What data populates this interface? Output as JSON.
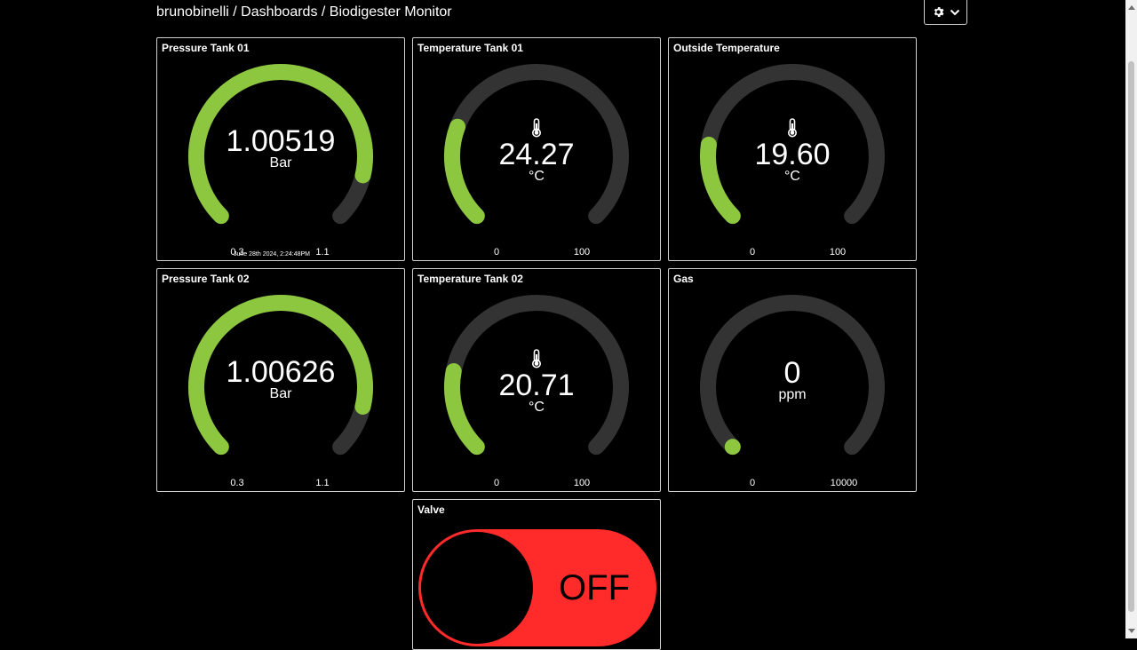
{
  "header": {
    "breadcrumb": "brunobinelli / Dashboards / Biodigester Monitor"
  },
  "colors": {
    "gauge_fill": "#8dc63f",
    "gauge_track": "#333333",
    "valve_off": "#ff2a2a",
    "tile_border": "#cfcfcf"
  },
  "widgets": {
    "pressure_tank_01": {
      "title": "Pressure Tank 01",
      "value": "1.00519",
      "unit": "Bar",
      "min": "0.3",
      "max": "1.1",
      "numeric": 1.00519,
      "range": [
        0.3,
        1.1
      ],
      "icon": "",
      "timestamp": "June 28th 2024, 2:24:48PM"
    },
    "temperature_tank_01": {
      "title": "Temperature Tank 01",
      "value": "24.27",
      "unit": "°C",
      "min": "0",
      "max": "100",
      "numeric": 24.27,
      "range": [
        0,
        100
      ],
      "icon": "thermometer-icon"
    },
    "outside_temperature": {
      "title": "Outside Temperature",
      "value": "19.60",
      "unit": "°C",
      "min": "0",
      "max": "100",
      "numeric": 19.6,
      "range": [
        0,
        100
      ],
      "icon": "thermometer-icon"
    },
    "pressure_tank_02": {
      "title": "Pressure Tank 02",
      "value": "1.00626",
      "unit": "Bar",
      "min": "0.3",
      "max": "1.1",
      "numeric": 1.00626,
      "range": [
        0.3,
        1.1
      ],
      "icon": ""
    },
    "temperature_tank_02": {
      "title": "Temperature Tank 02",
      "value": "20.71",
      "unit": "°C",
      "min": "0",
      "max": "100",
      "numeric": 20.71,
      "range": [
        0,
        100
      ],
      "icon": "thermometer-icon"
    },
    "gas": {
      "title": "Gas",
      "value": "0",
      "unit": "ppm",
      "min": "0",
      "max": "10000",
      "numeric": 0,
      "range": [
        0,
        10000
      ],
      "icon": ""
    },
    "valve": {
      "title": "Valve",
      "state": "OFF"
    }
  }
}
